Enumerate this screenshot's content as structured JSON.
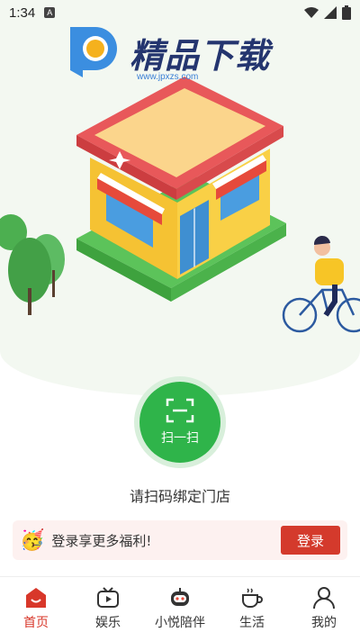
{
  "status_bar": {
    "time": "1:34",
    "notification_badge": "A"
  },
  "watermark": {
    "title": "精品下载",
    "url": "www.jpxzs.com"
  },
  "scan": {
    "label": "扫一扫"
  },
  "bind_prompt": "请扫码绑定门店",
  "promo": {
    "text": "登录享更多福利!",
    "button": "登录",
    "emoji": "🥳"
  },
  "tabs": [
    {
      "label": "首页",
      "icon": "home-icon",
      "active": true
    },
    {
      "label": "娱乐",
      "icon": "tv-play-icon",
      "active": false
    },
    {
      "label": "小悦陪伴",
      "icon": "robot-icon",
      "active": false
    },
    {
      "label": "生活",
      "icon": "coffee-cup-icon",
      "active": false
    },
    {
      "label": "我的",
      "icon": "user-icon",
      "active": false
    }
  ],
  "colors": {
    "accent": "#d8372a",
    "scan_green": "#2fb44a",
    "login_red": "#d43a2c"
  }
}
